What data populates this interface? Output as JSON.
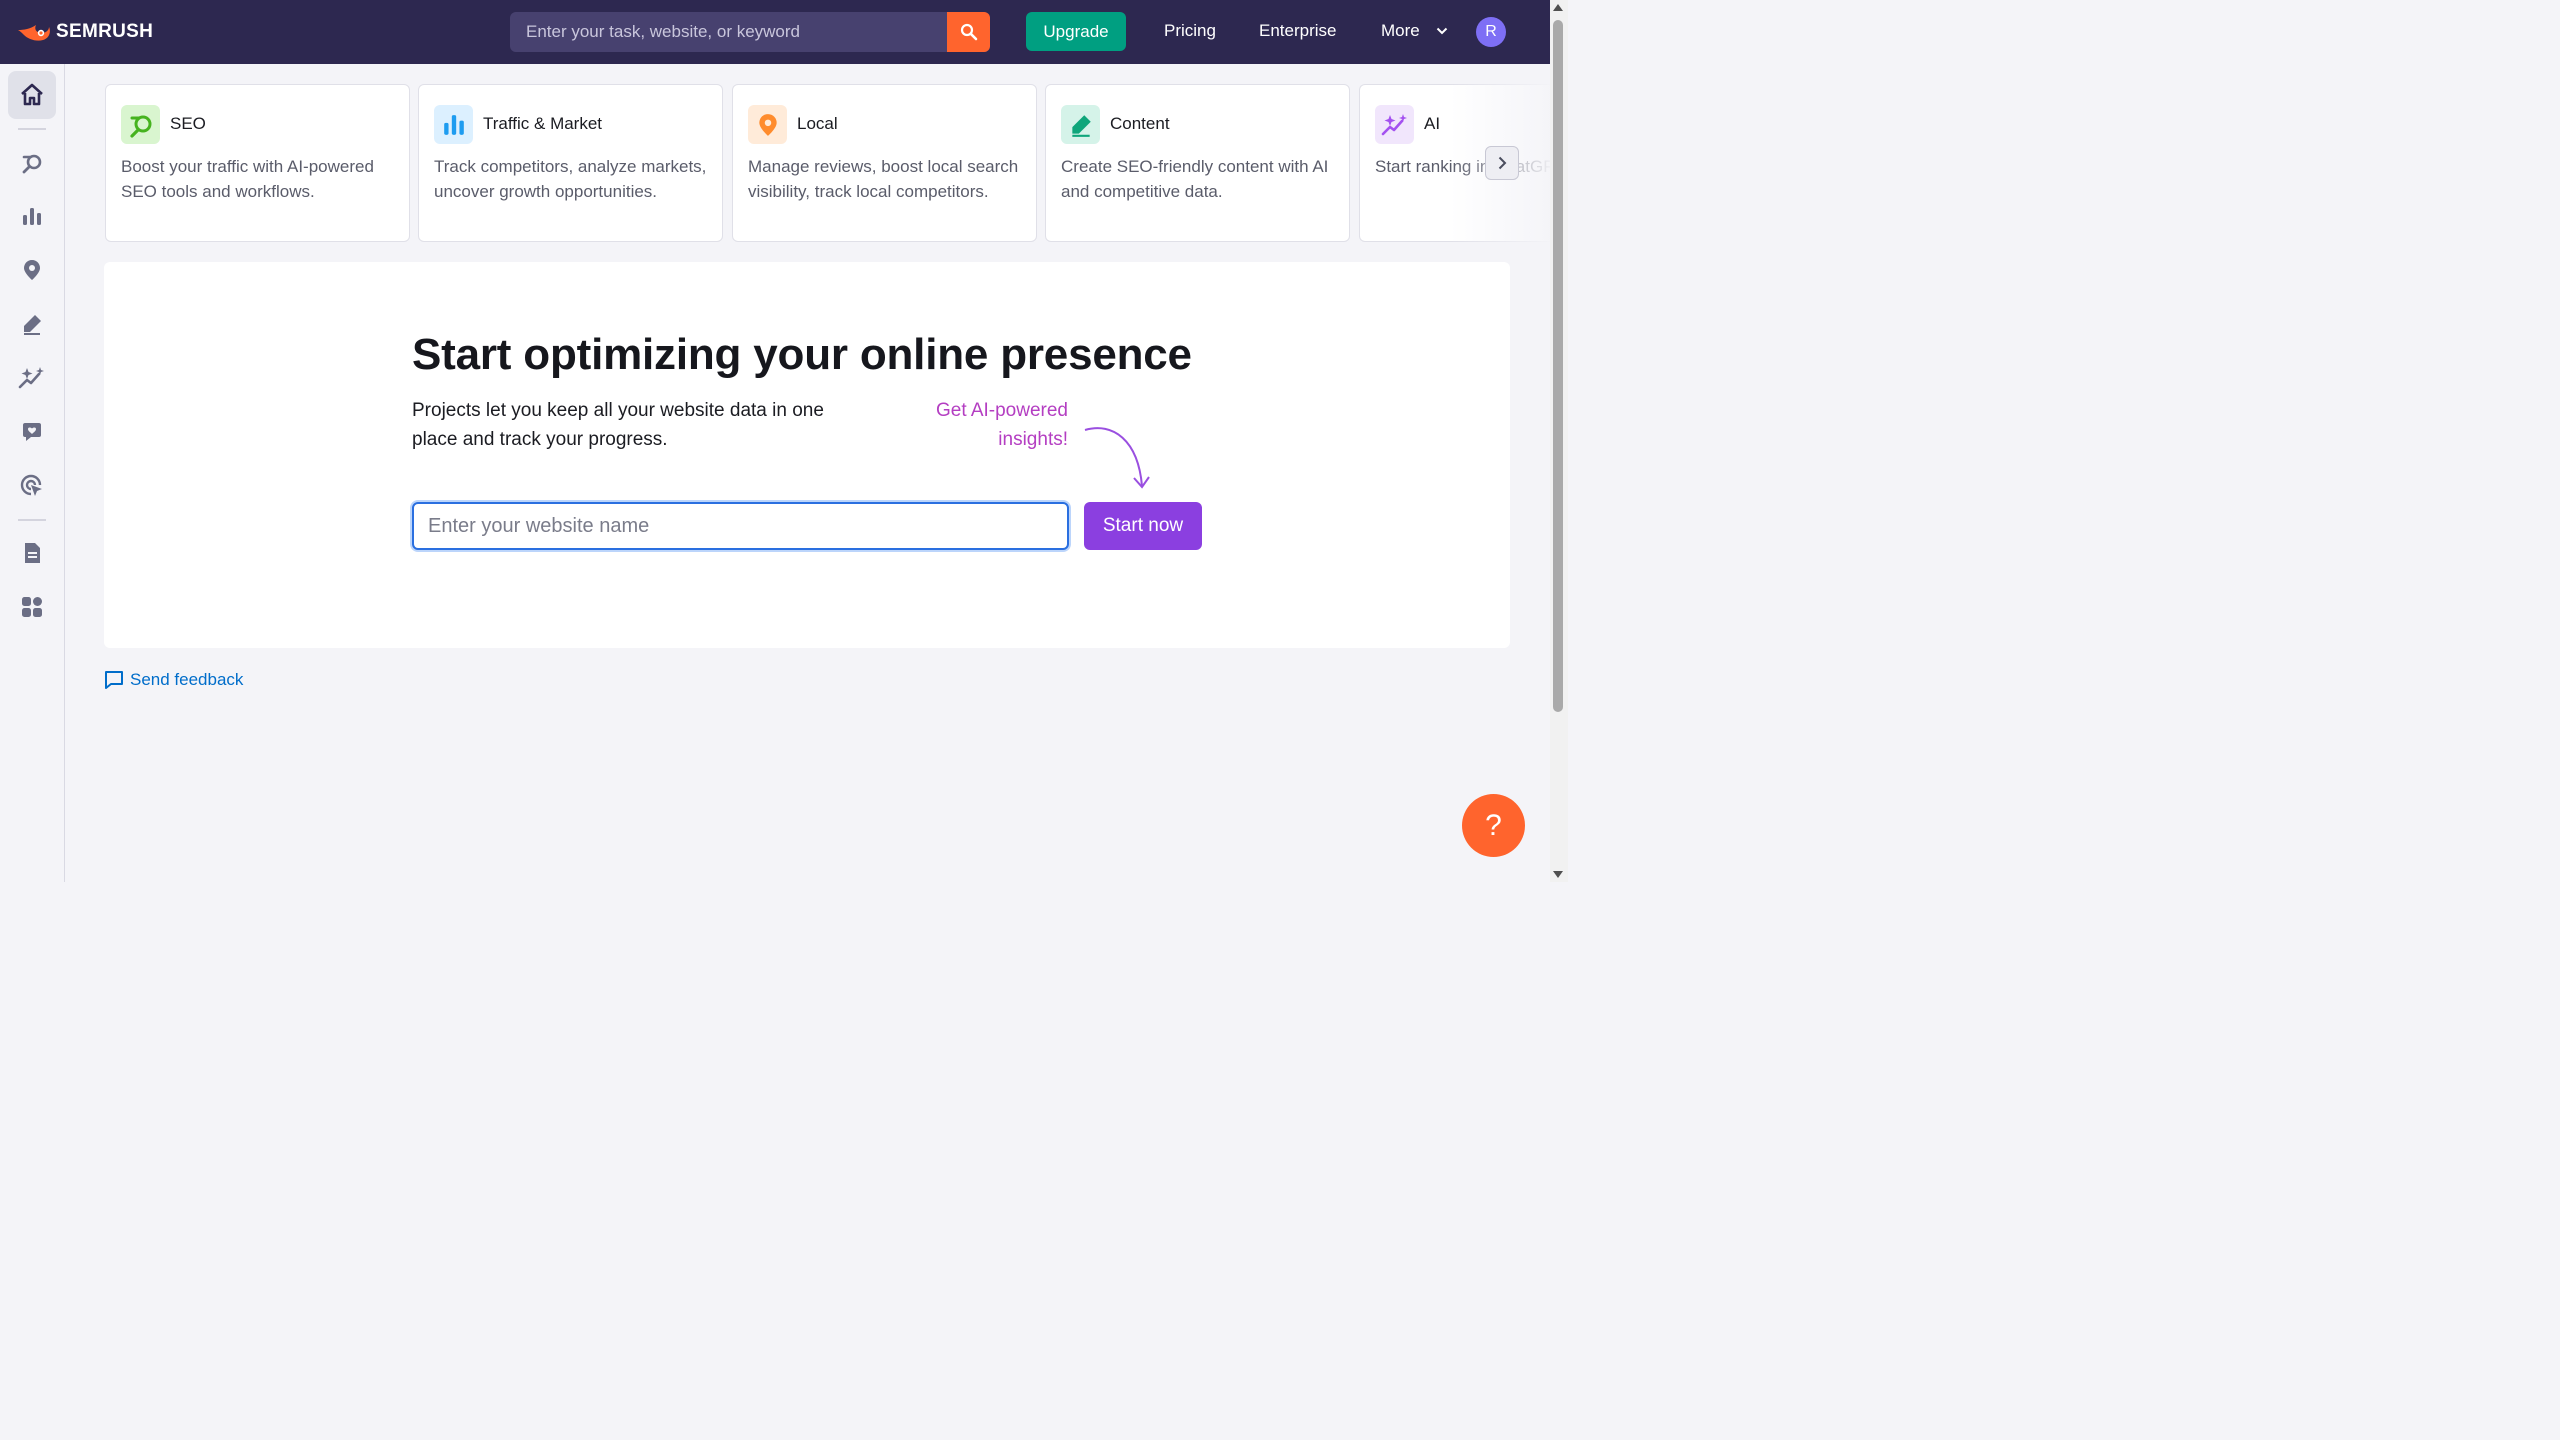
{
  "header": {
    "brand": "SEMRUSH",
    "search_placeholder": "Enter your task, website, or keyword",
    "upgrade_label": "Upgrade",
    "nav": [
      "Pricing",
      "Enterprise",
      "More"
    ],
    "avatar_initial": "R",
    "accent": "#ff642d",
    "bar_color": "#2d2850"
  },
  "sidebar": {
    "items": [
      {
        "icon": "home-icon"
      },
      {
        "icon": "seo-icon"
      },
      {
        "icon": "bar-chart-icon"
      },
      {
        "icon": "location-pin-icon"
      },
      {
        "icon": "pencil-icon"
      },
      {
        "icon": "sparkles-icon"
      },
      {
        "icon": "chat-heart-icon"
      },
      {
        "icon": "target-cursor-icon"
      },
      {
        "icon": "document-icon"
      },
      {
        "icon": "apps-icon"
      }
    ]
  },
  "cards": [
    {
      "title": "SEO",
      "desc": "Boost your traffic with AI-powered SEO tools and workflows.",
      "icon": "seo-icon"
    },
    {
      "title": "Traffic & Market",
      "desc": "Track competitors, analyze markets, uncover growth opportunities.",
      "icon": "bar-chart-icon"
    },
    {
      "title": "Local",
      "desc": "Manage reviews, boost local search visibility, track local competitors.",
      "icon": "location-pin-icon"
    },
    {
      "title": "Content",
      "desc": "Create SEO-friendly content with AI and competitive data.",
      "icon": "pencil-icon"
    },
    {
      "title": "AI",
      "desc": "Start ranking in ChatGPT and more",
      "icon": "sparkles-icon"
    }
  ],
  "main": {
    "heading": "Start optimizing your online presence",
    "subtext": "Projects let you keep all your website data in one place and track your progress.",
    "ai_note": "Get AI-powered insights!",
    "input_placeholder": "Enter your website name",
    "start_label": "Start now"
  },
  "feedback_label": "Send feedback",
  "help_label": "?"
}
